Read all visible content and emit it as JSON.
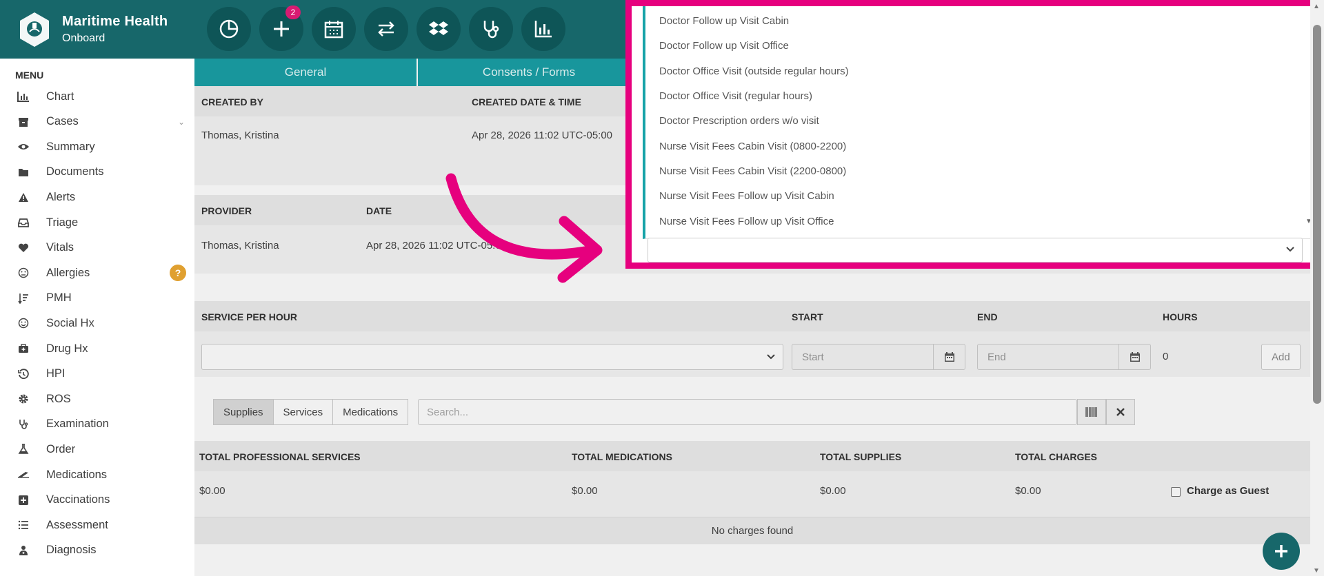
{
  "brand": {
    "name": "Maritime Health",
    "sub": "Onboard"
  },
  "toolbar": {
    "icons": [
      "pie-chart-icon",
      "plus-icon",
      "calendar-icon",
      "transfer-icon",
      "dropbox-icon",
      "stethoscope-icon",
      "bar-chart-icon"
    ],
    "badge_count": "2"
  },
  "sidebar": {
    "title": "MENU",
    "items": [
      {
        "label": "Chart",
        "icon": "bar-chart-icon"
      },
      {
        "label": "Cases",
        "icon": "archive-icon"
      },
      {
        "label": "Summary",
        "icon": "eye-icon"
      },
      {
        "label": "Documents",
        "icon": "folder-icon"
      },
      {
        "label": "Alerts",
        "icon": "warning-icon"
      },
      {
        "label": "Triage",
        "icon": "inbox-icon"
      },
      {
        "label": "Vitals",
        "icon": "heart-icon"
      },
      {
        "label": "Allergies",
        "icon": "face-icon"
      },
      {
        "label": "PMH",
        "icon": "sort-icon"
      },
      {
        "label": "Social Hx",
        "icon": "smile-icon"
      },
      {
        "label": "Drug Hx",
        "icon": "medkit-icon"
      },
      {
        "label": "HPI",
        "icon": "history-icon"
      },
      {
        "label": "ROS",
        "icon": "gear-icon"
      },
      {
        "label": "Examination",
        "icon": "stethoscope-icon"
      },
      {
        "label": "Order",
        "icon": "flask-icon"
      },
      {
        "label": "Medications",
        "icon": "pill-icon"
      },
      {
        "label": "Vaccinations",
        "icon": "plus-square-icon"
      },
      {
        "label": "Assessment",
        "icon": "list-icon"
      },
      {
        "label": "Diagnosis",
        "icon": "doctor-icon"
      }
    ],
    "allergies_badge": "?"
  },
  "tabs": [
    "General",
    "Consents / Forms"
  ],
  "created": {
    "headers": [
      "CREATED BY",
      "CREATED DATE & TIME"
    ],
    "by": "Thomas, Kristina",
    "datetime": "Apr 28, 2026 11:02 UTC-05:00"
  },
  "provider": {
    "headers": [
      "PROVIDER",
      "DATE"
    ],
    "name": "Thomas, Kristina",
    "date": "Apr 28, 2026 11:02 UTC-05:00"
  },
  "service": {
    "headers": [
      "SERVICE PER HOUR",
      "START",
      "END",
      "HOURS"
    ],
    "start_placeholder": "Start",
    "end_placeholder": "End",
    "hours": "0",
    "add_label": "Add"
  },
  "items_tabs": [
    "Supplies",
    "Services",
    "Medications"
  ],
  "search_placeholder": "Search...",
  "totals": {
    "headers": [
      "TOTAL PROFESSIONAL SERVICES",
      "TOTAL MEDICATIONS",
      "TOTAL SUPPLIES",
      "TOTAL CHARGES"
    ],
    "values": [
      "$0.00",
      "$0.00",
      "$0.00",
      "$0.00"
    ],
    "guest_label": "Charge as Guest",
    "empty": "No charges found"
  },
  "dropdown": {
    "options": [
      "Doctor Follow up Visit Cabin",
      "Doctor Follow up Visit Office",
      "Doctor Office Visit (outside regular hours)",
      "Doctor Office Visit (regular hours)",
      "Doctor Prescription orders w/o visit",
      "Nurse Visit Fees Cabin Visit (0800-2200)",
      "Nurse Visit Fees Cabin Visit (2200-0800)",
      "Nurse Visit Fees Follow up Visit Cabin",
      "Nurse Visit Fees Follow up Visit Office"
    ]
  },
  "colors": {
    "header": "#17676a",
    "tab": "#1aa0a6",
    "highlight": "#e6007e",
    "badge": "#d81b72"
  }
}
